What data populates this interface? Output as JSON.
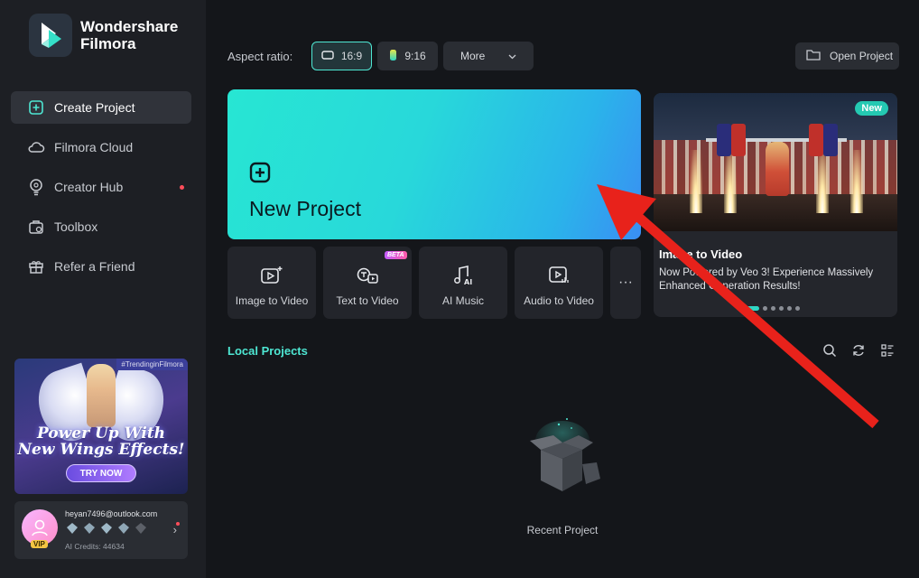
{
  "app": {
    "name": "Wondershare Filmora",
    "name_line1": "Wondershare",
    "name_line2": "Filmora"
  },
  "sidebar": {
    "items": [
      {
        "label": "Create Project",
        "icon": "create-project-icon",
        "active": true
      },
      {
        "label": "Filmora Cloud",
        "icon": "cloud-icon"
      },
      {
        "label": "Creator Hub",
        "icon": "lightbulb-icon",
        "notification_dot": true
      },
      {
        "label": "Toolbox",
        "icon": "toolbox-icon"
      },
      {
        "label": "Refer a Friend",
        "icon": "gift-icon"
      }
    ],
    "promo": {
      "tag": "#TrendinginFilmora",
      "headline_line1": "Power Up With",
      "headline_line2": "New Wings Effects!",
      "cta": "TRY NOW"
    },
    "account": {
      "email": "heyan7496@outlook.com",
      "badge": "VIP",
      "credits": "AI Credits: 44634",
      "chevron": "›"
    }
  },
  "toolbar": {
    "aspect_label": "Aspect ratio:",
    "ratios": [
      {
        "label": "16:9",
        "selected": true
      },
      {
        "label": "9:16",
        "selected": false
      }
    ],
    "more": "More",
    "open_project": "Open Project"
  },
  "new_project": {
    "label": "New Project"
  },
  "tools": [
    {
      "label": "Image to Video",
      "icon": "image-to-video-icon"
    },
    {
      "label": "Text to Video",
      "icon": "text-to-video-icon",
      "badge": "BETA"
    },
    {
      "label": "AI Music",
      "icon": "ai-music-icon"
    },
    {
      "label": "Audio to Video",
      "icon": "audio-to-video-icon"
    }
  ],
  "tools_more": "···",
  "feature_card": {
    "badge": "New",
    "title": "Image to Video",
    "description": "Now Powered by Veo 3! Experience Massively Enhanced Generation Results!",
    "slide_count": 6,
    "active_slide": 1
  },
  "local_projects": {
    "title": "Local Projects",
    "empty_label": "Recent Project"
  },
  "colors": {
    "accent": "#4ee7d3",
    "sidebar_bg": "#1d1f24",
    "main_bg": "#14161a",
    "annotation_arrow": "#e8221b"
  }
}
